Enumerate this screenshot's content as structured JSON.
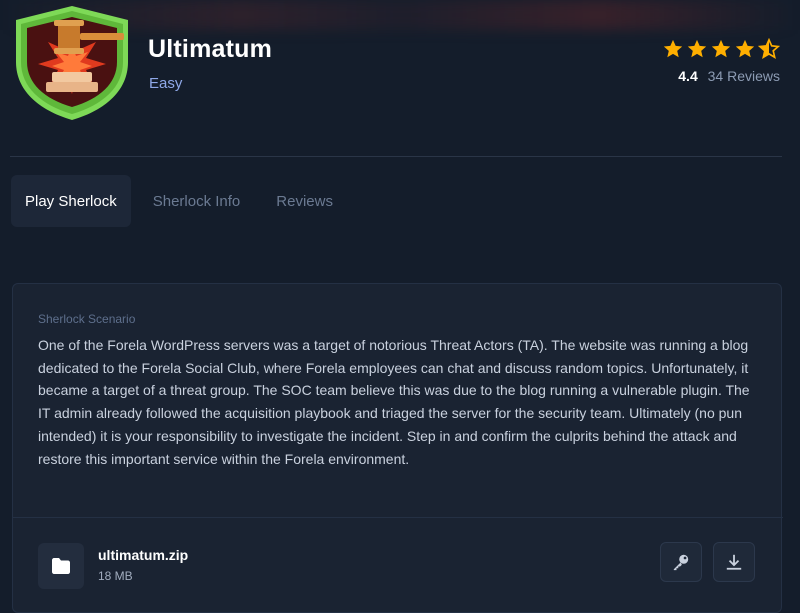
{
  "header": {
    "title": "Ultimatum",
    "difficulty": "Easy",
    "rating_value": "4.4",
    "reviews_label": "34 Reviews",
    "stars": 4.5,
    "star_color": "#ffaf00"
  },
  "tabs": [
    {
      "label": "Play Sherlock",
      "active": true
    },
    {
      "label": "Sherlock Info",
      "active": false
    },
    {
      "label": "Reviews",
      "active": false
    }
  ],
  "scenario": {
    "label": "Sherlock Scenario",
    "text": "One of the Forela WordPress servers was a target of notorious Threat Actors (TA). The website was running a blog dedicated to the Forela Social Club, where Forela employees can chat and discuss random topics. Unfortunately, it became a target of a threat group. The SOC team believe this was due to the blog running a vulnerable plugin. The IT admin already followed the acquisition playbook and triaged the server for the security team. Ultimately (no pun intended) it is your responsibility to investigate the incident. Step in and confirm the culprits behind the attack and restore this important service within the Forela environment."
  },
  "file": {
    "name": "ultimatum.zip",
    "size": "18 MB",
    "icon": "folder-icon"
  },
  "actions": {
    "key_icon": "key-icon",
    "download_icon": "download-icon"
  },
  "colors": {
    "background": "#141d2b",
    "card": "#1a2332",
    "accent_green": "#6fcf3f",
    "difficulty": "#8fa8e8"
  }
}
